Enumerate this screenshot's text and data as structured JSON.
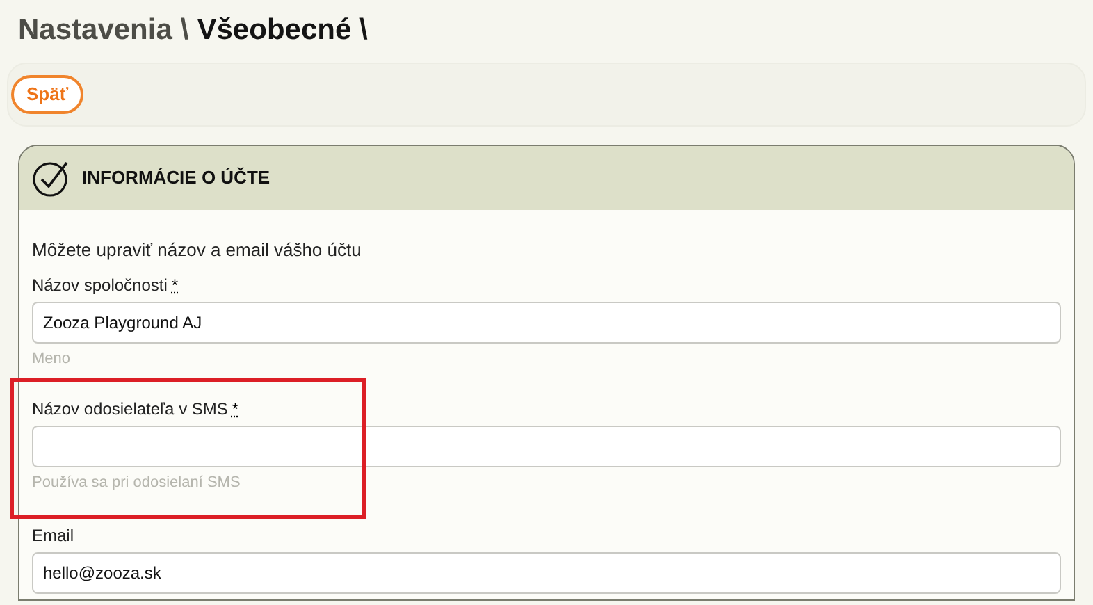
{
  "breadcrumb": [
    {
      "label": "Nastavenia",
      "current": false
    },
    {
      "label": "\\",
      "current": false
    },
    {
      "label": "Všeobecné \\",
      "current": true
    }
  ],
  "back_button": {
    "label": "Späť"
  },
  "card": {
    "title": "INFORMÁCIE O ÚČTE",
    "description": "Môžete upraviť názov a email vášho účtu",
    "fields": [
      {
        "label": "Názov spoločnosti",
        "required_mark": "*",
        "value": "Zooza Playground AJ",
        "hint": "Meno",
        "highlighted": false
      },
      {
        "label": "Názov odosielateľa v SMS",
        "required_mark": "*",
        "hint": "Používa sa pri odosielaní SMS",
        "highlighted": true
      },
      {
        "label": "Email",
        "value": "hello@zooza.sk",
        "highlighted": false
      }
    ]
  }
}
